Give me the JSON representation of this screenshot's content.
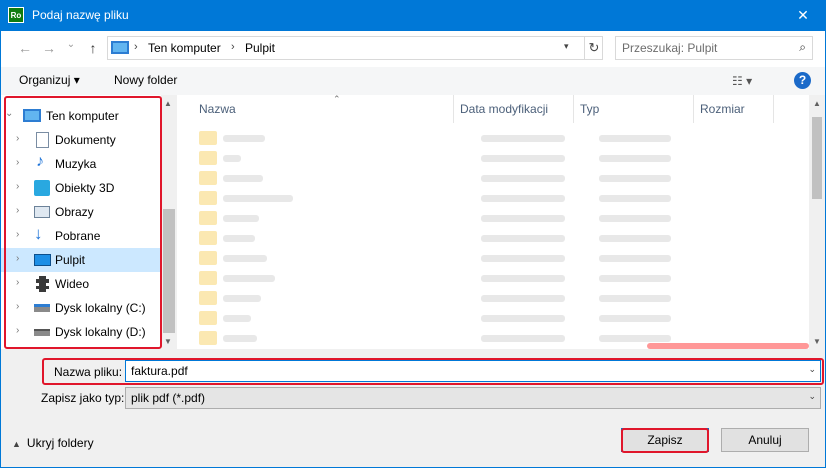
{
  "window": {
    "title": "Podaj nazwę pliku",
    "app_icon_text": "Ro",
    "close_glyph": "✕"
  },
  "nav": {
    "back_glyph": "←",
    "forward_glyph": "→",
    "recent_glyph": "⌄",
    "up_glyph": "↑",
    "breadcrumbs": [
      "Ten komputer",
      "Pulpit"
    ],
    "breadcrumb_sep": "›",
    "refresh_glyph": "↻",
    "search_placeholder": "Przeszukaj: Pulpit",
    "search_glyph": "⌕"
  },
  "toolbar": {
    "organize_label": "Organizuj ▾",
    "new_folder_label": "Nowy folder",
    "view_glyph": "☷ ▾",
    "help_glyph": "?"
  },
  "sidebar": {
    "root": {
      "label": "Ten komputer",
      "icon": "computer-icon"
    },
    "items": [
      {
        "label": "Dokumenty",
        "icon": "documents-icon"
      },
      {
        "label": "Muzyka",
        "icon": "music-icon"
      },
      {
        "label": "Obiekty 3D",
        "icon": "objects-3d-icon"
      },
      {
        "label": "Obrazy",
        "icon": "pictures-icon"
      },
      {
        "label": "Pobrane",
        "icon": "downloads-icon"
      },
      {
        "label": "Pulpit",
        "icon": "desktop-icon",
        "selected": true
      },
      {
        "label": "Wideo",
        "icon": "video-icon"
      },
      {
        "label": "Dysk lokalny (C:)",
        "icon": "drive-c-icon"
      },
      {
        "label": "Dysk lokalny (D:)",
        "icon": "drive-d-icon"
      }
    ]
  },
  "columns": [
    "Nazwa",
    "Data modyfikacji",
    "Typ",
    "Rozmiar"
  ],
  "form": {
    "filename_label": "Nazwa pliku:",
    "filename_value": "faktura.pdf",
    "type_label": "Zapisz jako typ:",
    "type_value": "plik pdf (*.pdf)"
  },
  "footer": {
    "hide_folders_label": "Ukryj foldery",
    "save_label": "Zapisz",
    "cancel_label": "Anuluj"
  },
  "colors": {
    "accent": "#0078d7",
    "highlight": "#e0162b",
    "selection": "#cce8ff"
  }
}
